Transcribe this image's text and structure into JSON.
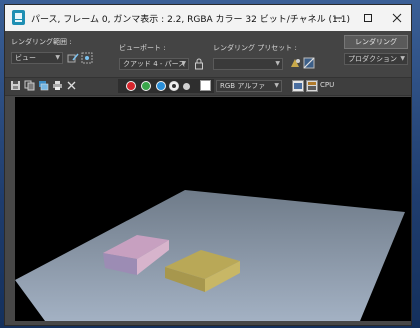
{
  "window": {
    "title": "パース, フレーム 0, ガンマ表示 : 2.2, RGBA カラー 32 ビット/チャネル (1:1)"
  },
  "toolbar": {
    "area_label": "レンダリング範囲 :",
    "area_value": "ビュー",
    "viewport_label": "ビューポート :",
    "viewport_value": "クアッド 4 - パース",
    "preset_label": "レンダリング プリセット :",
    "preset_value": "",
    "render_button": "レンダリング",
    "mode_value": "プロダクション"
  },
  "toolbar2": {
    "channel_value": "RGB アルファ",
    "cpu_label": "CPU"
  },
  "colors": {
    "red": "#d7262d",
    "green": "#3aa64a",
    "blue": "#2a8fd9",
    "viewport_bg": "#000000",
    "plane": "#8b98a8",
    "pink_box": "#c7a0c0",
    "yellow_box": "#b9a857"
  }
}
